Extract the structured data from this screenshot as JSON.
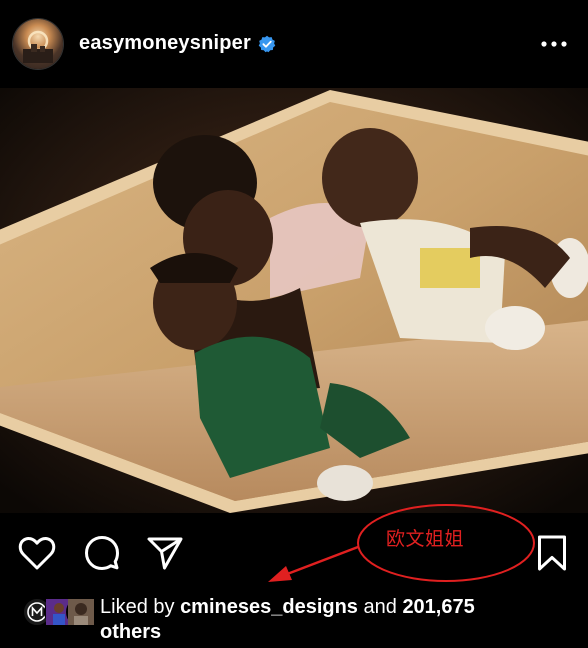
{
  "post": {
    "username": "easymoneysniper",
    "verified": true,
    "more_icon": "more-horizontal-icon"
  },
  "actions": {
    "like_icon": "heart-icon",
    "comment_icon": "comment-icon",
    "share_icon": "paper-plane-icon",
    "save_icon": "bookmark-icon"
  },
  "annotation": {
    "text": "欧文姐姐",
    "color": "#e02020"
  },
  "likes": {
    "prefix": "Liked by",
    "user": "cmineses_designs",
    "middle": "and",
    "count": "201,675",
    "suffix": "others"
  },
  "colors": {
    "background": "#000000",
    "text": "#ffffff",
    "verified_badge": "#3897f0",
    "annotation": "#e02020"
  }
}
